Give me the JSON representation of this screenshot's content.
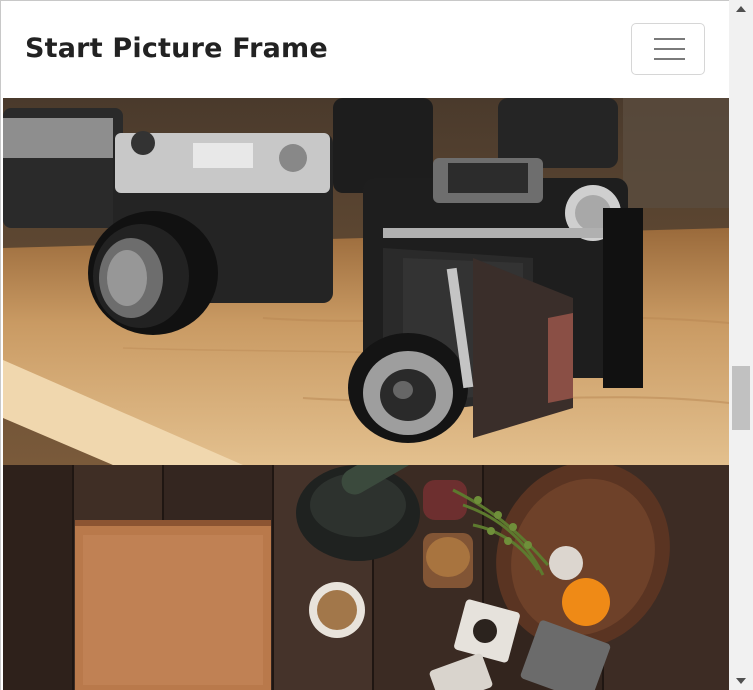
{
  "navbar": {
    "brand": "Start Picture Frame",
    "toggler_icon": "hamburger-menu-icon"
  },
  "gallery": {
    "images": [
      {
        "subject": "vintage-cameras-on-wooden-shelf"
      },
      {
        "subject": "rustic-kitchen-table-with-cutting-board-mortar-and-spices"
      }
    ]
  },
  "scrollbar": {
    "up_icon": "chevron-up-icon",
    "down_icon": "chevron-down-icon",
    "position": 0.6
  }
}
